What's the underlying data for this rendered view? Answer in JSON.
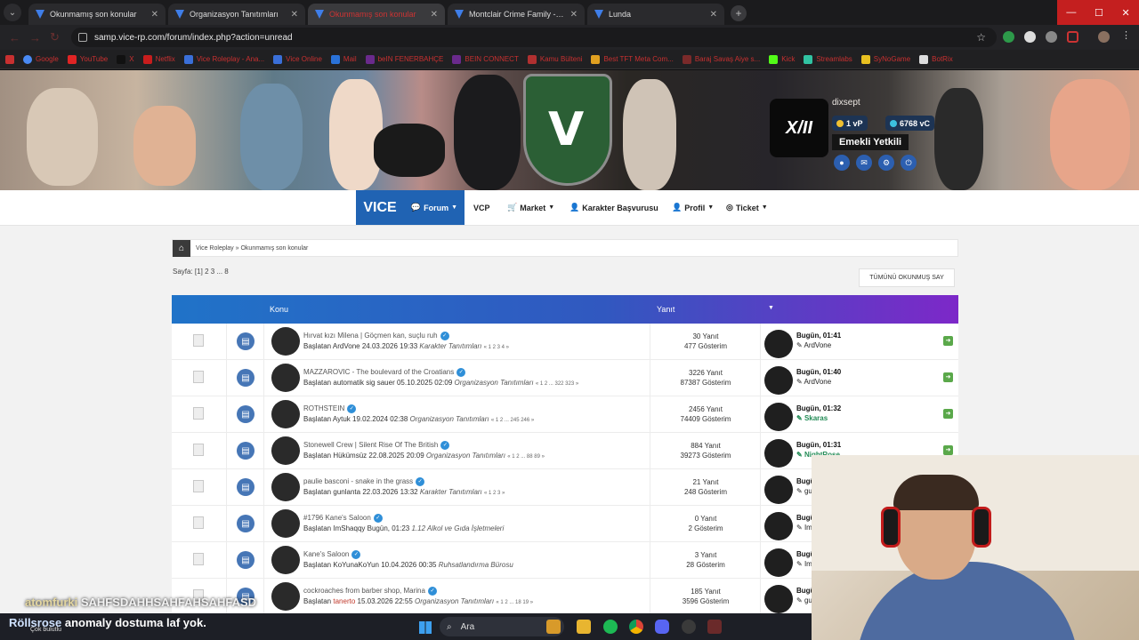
{
  "browser": {
    "tabs": [
      {
        "title": "Okunmamış son konular",
        "active": false
      },
      {
        "title": "Organizasyon Tanıtımları",
        "active": false
      },
      {
        "title": "Okunmamış son konular",
        "active": true
      },
      {
        "title": "Montclair Crime Family - Vice",
        "active": false
      },
      {
        "title": "Lunda",
        "active": false
      }
    ],
    "url": "samp.vice-rp.com/forum/index.php?action=unread",
    "bookmarks": [
      {
        "label": "Google",
        "color": "#4a8af4"
      },
      {
        "label": "YouTube",
        "color": "#e02424"
      },
      {
        "label": "X",
        "color": "#111111"
      },
      {
        "label": "Netflix",
        "color": "#c81d1d"
      },
      {
        "label": "Vice Roleplay - Ana...",
        "color": "#3a6fd8"
      },
      {
        "label": "Vice Online",
        "color": "#3a6fd8"
      },
      {
        "label": "Mail",
        "color": "#2a72d8"
      },
      {
        "label": "beIN FENERBAHÇE",
        "color": "#6a2a8c"
      },
      {
        "label": "BEIN CONNECT",
        "color": "#6a2a8c"
      },
      {
        "label": "Kamu Bülteni",
        "color": "#b03030"
      },
      {
        "label": "Best TFT Meta Com...",
        "color": "#e0a020"
      },
      {
        "label": "Baraj Savaş Aiye s...",
        "color": "#7a2a2a"
      },
      {
        "label": "Kick",
        "color": "#53fc18"
      },
      {
        "label": "Streamlabs",
        "color": "#31c3a2"
      },
      {
        "label": "SyNoGame",
        "color": "#e8c020"
      },
      {
        "label": "BotRix",
        "color": "#dddddd"
      }
    ]
  },
  "user": {
    "name": "dixsept",
    "vp": "1 vP",
    "vc": "6768 vC",
    "rank": "Emekli Yetkili",
    "avatar_text": "X/II"
  },
  "nav": {
    "brand": "VICE",
    "items": [
      "Forum",
      "VCP",
      "Market",
      "Karakter Başvurusu",
      "Profil",
      "Ticket"
    ]
  },
  "breadcrumb": {
    "root": "Vice Roleplay",
    "current": "Okunmamış son konular"
  },
  "pagination": {
    "label": "Sayfa:",
    "current": "[1]",
    "rest": "2 3 ... 8"
  },
  "mark_all_button": "TÜMÜNÜ OKUNMUŞ SAY",
  "table": {
    "col_topic": "Konu",
    "col_replies": "Yanıt",
    "rows": [
      {
        "title": "Hırvat kızı Milena | Göçmen kan, suçlu ruh",
        "started_by": "Başlatan",
        "author": "ArdVone",
        "date": "24.03.2026 19:33",
        "forum": "Karakter Tanıtımları",
        "pages": "« 1 2 3 4 »",
        "replies": "30 Yanıt",
        "views": "477 Gösterim",
        "last_time": "Bugün, 01:41",
        "last_user": "ArdVone",
        "last_user_green": false
      },
      {
        "title": "MAZZAROVIC - The boulevard of the Croatians",
        "started_by": "Başlatan",
        "author": "automatik sig sauer",
        "date": "05.10.2025 02:09",
        "forum": "Organizasyon Tanıtımları",
        "pages": "« 1 2 ... 322 323 »",
        "replies": "3226 Yanıt",
        "views": "87387 Gösterim",
        "last_time": "Bugün, 01:40",
        "last_user": "ArdVone",
        "last_user_green": false
      },
      {
        "title": "ROTHSTEIN",
        "started_by": "Başlatan",
        "author": "Aytuk",
        "date": "19.02.2024 02:38",
        "forum": "Organizasyon Tanıtımları",
        "pages": "« 1 2 ... 245 246 »",
        "replies": "2456 Yanıt",
        "views": "74409 Gösterim",
        "last_time": "Bugün, 01:32",
        "last_user": "Skaras",
        "last_user_green": true
      },
      {
        "title": "Stonewell Crew | Silent Rise Of The British",
        "started_by": "Başlatan",
        "author": "Hükümsüz",
        "date": "22.08.2025 20:09",
        "forum": "Organizasyon Tanıtımları",
        "pages": "« 1 2 ... 88 89 »",
        "replies": "884 Yanıt",
        "views": "39273 Gösterim",
        "last_time": "Bugün, 01:31",
        "last_user": "NightRose",
        "last_user_green": true
      },
      {
        "title": "paulie basconi - snake in the grass",
        "started_by": "Başlatan",
        "author": "gunlanta",
        "date": "22.03.2026 13:32",
        "forum": "Karakter Tanıtımları",
        "pages": "« 1 2 3 »",
        "replies": "21 Yanıt",
        "views": "248 Gösterim",
        "last_time": "Bugün",
        "last_user": "gu",
        "last_user_green": false
      },
      {
        "title": "#1796 Kane's Saloon",
        "started_by": "Başlatan",
        "author": "ImShaqqy",
        "date": "Bugün, 01:23",
        "forum": "1.12 Alkol ve Gıda İşletmeleri",
        "pages": "",
        "replies": "0 Yanıt",
        "views": "2 Gösterim",
        "last_time": "Bugün",
        "last_user": "Im",
        "last_user_green": false
      },
      {
        "title": "Kane's Saloon",
        "started_by": "Başlatan",
        "author": "KoYunaKoYun",
        "date": "10.04.2026 00:35",
        "forum": "Ruhsatlandırma Bürosu",
        "pages": "",
        "replies": "3 Yanıt",
        "views": "28 Gösterim",
        "last_time": "Bugün",
        "last_user": "Im",
        "last_user_green": false
      },
      {
        "title": "cockroaches from barber shop, Marina",
        "started_by": "Başlatan",
        "author": "tanerto",
        "date": "15.03.2026 22:55",
        "forum": "Organizasyon Tanıtımları",
        "pages": "« 1 2 ... 18 19 »",
        "replies": "185 Yanıt",
        "views": "3596 Gösterim",
        "last_time": "Bugün",
        "last_user": "gu",
        "last_user_green": false
      }
    ]
  },
  "stream_chat": [
    {
      "user": "atomfurki",
      "message": "SAHFSDAHHSAHFAHSAHFASD"
    },
    {
      "user": "Röllsrose",
      "message": "anomaly dostuma laf yok."
    }
  ],
  "taskbar": {
    "weather": "Çok bulutlu",
    "search_placeholder": "Ara"
  }
}
